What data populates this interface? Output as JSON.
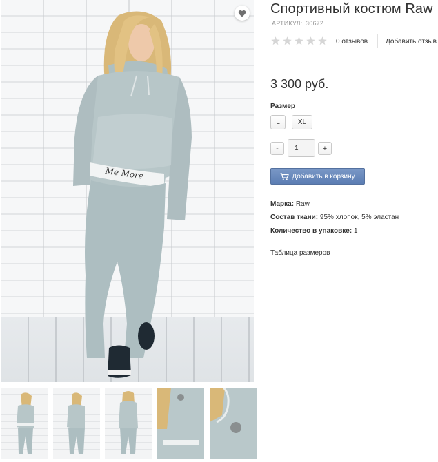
{
  "product": {
    "title": "Спортивный костюм Raw",
    "sku_label": "АРТИКУЛ:",
    "sku": "30672",
    "rating": 0,
    "rating_max": 5,
    "reviews_count": "0 отзывов",
    "add_review": "Добавить отзыв",
    "price": "3 300 руб.",
    "size_label": "Размер",
    "sizes": [
      "L",
      "XL"
    ],
    "quantity": "1",
    "qty_minus": "-",
    "qty_plus": "+",
    "add_to_cart": "Добавить в корзину",
    "attributes": [
      {
        "label": "Марка:",
        "value": "Raw"
      },
      {
        "label": "Состав ткани:",
        "value": "95% хлопок, 5% эластан"
      },
      {
        "label": "Количество в упаковке:",
        "value": "1"
      }
    ],
    "size_table_link": "Таблица размеров"
  },
  "gallery": {
    "main_photo_text": "Me More",
    "thumbnail_count": 5
  },
  "icons": {
    "favorite": "heart-icon",
    "cart": "shopping-cart-icon",
    "star": "star-icon"
  },
  "colors": {
    "accent": "#5b7db3",
    "star_empty": "#d6d6d6",
    "suit": "#b7c6c8"
  }
}
